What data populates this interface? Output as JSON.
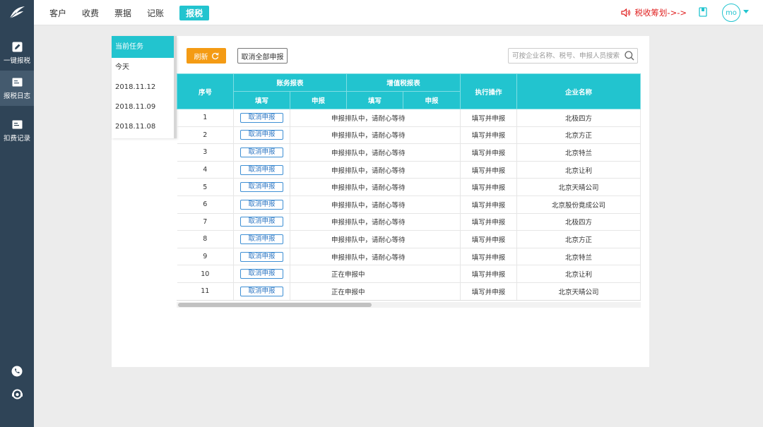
{
  "colors": {
    "accent": "#22c4cf",
    "rail": "#2f4457",
    "refresh": "#f49b14",
    "notice": "#e02020",
    "link": "#2a74c2"
  },
  "rail": {
    "items": [
      {
        "label": "一键报税",
        "icon": "pencil-icon"
      },
      {
        "label": "报税日志",
        "icon": "log-icon"
      },
      {
        "label": "扣费记录",
        "icon": "fee-record-icon"
      }
    ]
  },
  "topbar": {
    "menu": [
      "客户",
      "收费",
      "票据",
      "记账",
      "报税"
    ],
    "active_menu": "报税",
    "notice": "税收筹划->->",
    "avatar": "mo"
  },
  "tasks": {
    "header": "当前任务",
    "items": [
      "今天",
      "2018.11.12",
      "2018.11.09",
      "2018.11.08"
    ]
  },
  "toolbar": {
    "refresh_label": "刷新",
    "cancel_all_label": "取消全部申报",
    "search_placeholder": "可按企业名称、税号、申报人员搜索"
  },
  "table": {
    "headers": {
      "seq": "序号",
      "accounting": "账务报表",
      "vat": "增值税报表",
      "fill": "填写",
      "declare": "申报",
      "action": "执行操作",
      "company": "企业名称"
    },
    "cancel_label": "取消申报",
    "rows": [
      {
        "seq": "1",
        "status": "申报排队中，请耐心等待",
        "action": "填写并申报",
        "company": "北极四方"
      },
      {
        "seq": "2",
        "status": "申报排队中，请耐心等待",
        "action": "填写并申报",
        "company": "北京方正"
      },
      {
        "seq": "3",
        "status": "申报排队中，请耐心等待",
        "action": "填写并申报",
        "company": "北京特兰"
      },
      {
        "seq": "4",
        "status": "申报排队中，请耐心等待",
        "action": "填写并申报",
        "company": "北京让利"
      },
      {
        "seq": "5",
        "status": "申报排队中，请耐心等待",
        "action": "填写并申报",
        "company": "北京天晴公司"
      },
      {
        "seq": "6",
        "status": "申报排队中，请耐心等待",
        "action": "填写并申报",
        "company": "北京股份竟成公司"
      },
      {
        "seq": "7",
        "status": "申报排队中，请耐心等待",
        "action": "填写并申报",
        "company": "北极四方"
      },
      {
        "seq": "8",
        "status": "申报排队中，请耐心等待",
        "action": "填写并申报",
        "company": "北京方正"
      },
      {
        "seq": "9",
        "status": "申报排队中，请耐心等待",
        "action": "填写并申报",
        "company": "北京特兰"
      },
      {
        "seq": "10",
        "status": "正在申报中",
        "action": "填写并申报",
        "company": "北京让利"
      },
      {
        "seq": "11",
        "status": "正在申报中",
        "action": "填写并申报",
        "company": "北京天晴公司"
      }
    ]
  }
}
